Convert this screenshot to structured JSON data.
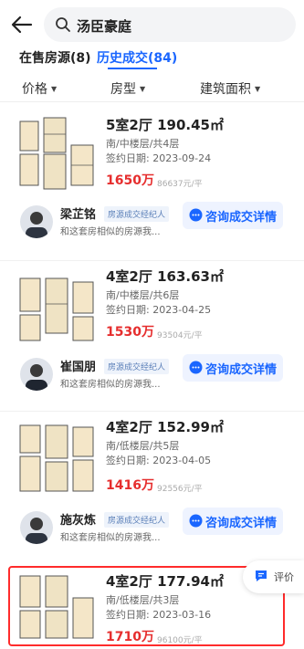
{
  "search": {
    "text": "汤臣豪庭"
  },
  "tabs": [
    {
      "label": "在售房源(8)"
    },
    {
      "label": "历史成交(84)"
    }
  ],
  "filters": [
    {
      "label": "价格"
    },
    {
      "label": "房型"
    },
    {
      "label": "建筑面积"
    }
  ],
  "listings": [
    {
      "title": "5室2厅 190.45㎡",
      "detail": "南/中楼层/共4层",
      "date": "签约日期: 2023-09-24",
      "price": "1650万",
      "unit_price": "86637元/平",
      "agent": {
        "name": "梁芷铭",
        "badge": "房源成交经纪人",
        "desc": "和这套房相似的房源我...",
        "consult": "咨询成交详情"
      }
    },
    {
      "title": "4室2厅 163.63㎡",
      "detail": "南/中楼层/共6层",
      "date": "签约日期: 2023-04-25",
      "price": "1530万",
      "unit_price": "93504元/平",
      "agent": {
        "name": "崔国朋",
        "badge": "房源成交经纪人",
        "desc": "和这套房相似的房源我...",
        "consult": "咨询成交详情"
      }
    },
    {
      "title": "4室2厅 152.99㎡",
      "detail": "南/低楼层/共5层",
      "date": "签约日期: 2023-04-05",
      "price": "1416万",
      "unit_price": "92556元/平",
      "agent": {
        "name": "施灰炼",
        "badge": "房源成交经纪人",
        "desc": "和这套房相似的房源我...",
        "consult": "咨询成交详情"
      }
    },
    {
      "title": "4室2厅 177.94㎡",
      "detail": "南/低楼层/共3层",
      "date": "签约日期: 2023-03-16",
      "price": "1710万",
      "unit_price": "96100元/平"
    }
  ],
  "review": {
    "label": "评价"
  },
  "colors": {
    "accent": "#1a66ff",
    "price": "#e62e2e",
    "highlight": "#ff2b2b"
  }
}
